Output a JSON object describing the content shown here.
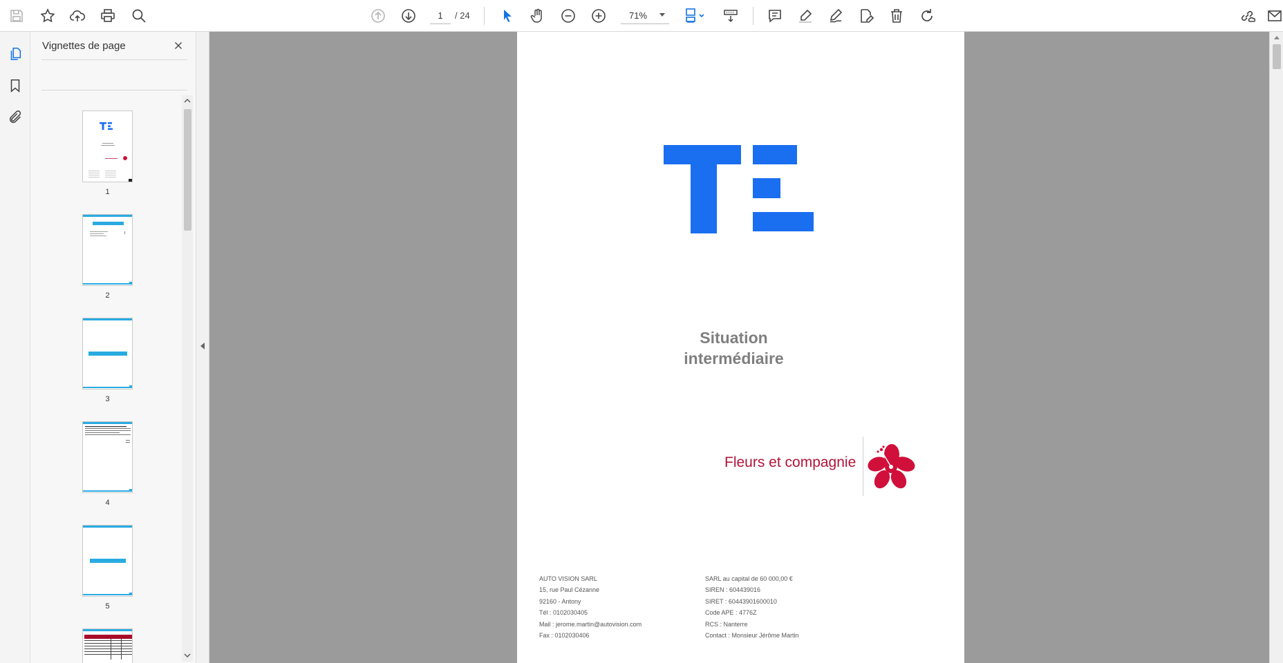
{
  "toolbar": {
    "page_current": "1",
    "page_total": "/ 24",
    "zoom": "71%",
    "accent": "#1473e6"
  },
  "panel": {
    "title": "Vignettes de page",
    "thumbnails": [
      {
        "label": "1"
      },
      {
        "label": "2"
      },
      {
        "label": "3"
      },
      {
        "label": "4"
      },
      {
        "label": "5"
      }
    ]
  },
  "document": {
    "title_line1": "Situation",
    "title_line2": "intermédiaire",
    "brand_name": "Fleurs et compagnie",
    "brand_color": "#b0143a",
    "logo_color": "#1a6ef0",
    "company_left": [
      "AUTO VISION SARL",
      "15, rue Paul Cézanne",
      "92160 - Antony",
      "Tél : 0102030405",
      "Mail : jerome.martin@autovision.com",
      "Fax : 0102030406"
    ],
    "company_right": [
      "SARL au capital de 60 000,00 €",
      "SIREN : 604439016",
      "SIRET : 60443901600010",
      "Code APE : 4776Z",
      "RCS : Nanterre",
      "Contact : Monsieur Jérôme Martin"
    ]
  }
}
